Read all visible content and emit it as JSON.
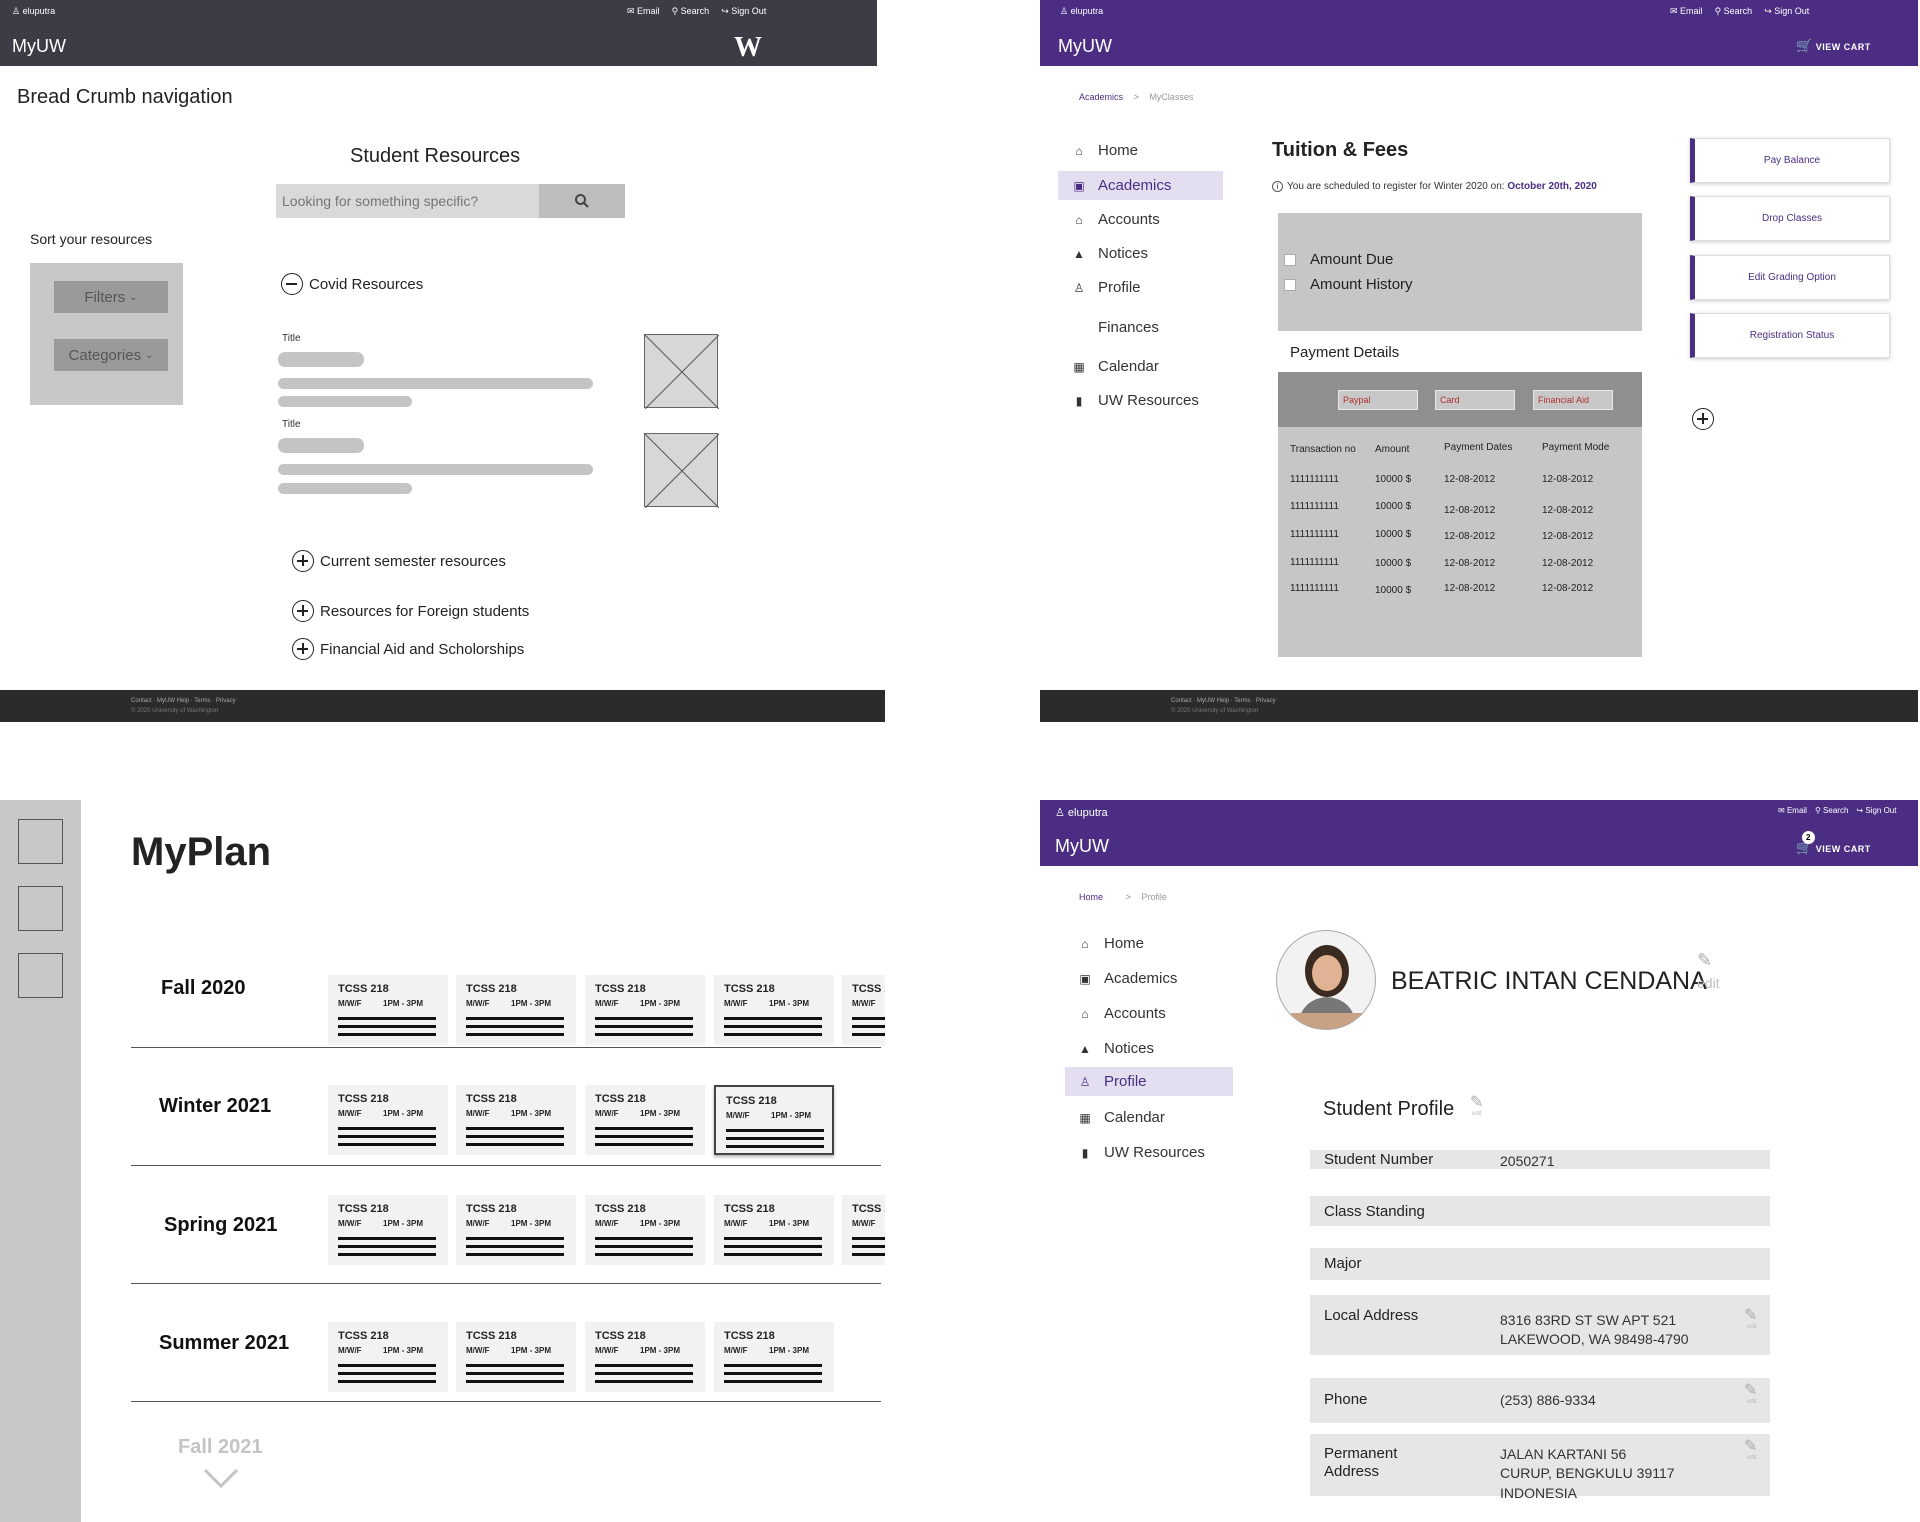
{
  "p1": {
    "user": "eluputra",
    "links": [
      "Email",
      "Search",
      "Sign Out"
    ],
    "brand": "MyUW",
    "logo": "W",
    "bc": "Bread Crumb navigation",
    "sr": "Student Resources",
    "placeholder": "Looking for something specific?",
    "sort": "Sort your resources",
    "filters": "Filters",
    "categories": "Categories",
    "covid": "Covid Resources",
    "title1": "Title",
    "title2": "Title",
    "current": "Current semester resources",
    "foreign": "Resources for Foreign students",
    "aid": "Financial Aid and Scholorships",
    "footer_links": "Contact · MyUW Help · Terms · Privacy",
    "copyright": "© 2020 University of Washington"
  },
  "p2": {
    "user": "eluputra",
    "links": [
      "Email",
      "Search",
      "Sign Out"
    ],
    "brand": "MyUW",
    "cart": "VIEW CART",
    "crumb1": "Academics",
    "crumb2": "MyClasses",
    "nav": [
      "Home",
      "Academics",
      "Accounts",
      "Notices",
      "Profile",
      "Finances",
      "Calendar",
      "UW Resources"
    ],
    "heading": "Tuition & Fees",
    "notice": "You are scheduled to register for Winter 2020 on:",
    "notice_date": "October 20th, 2020",
    "due": "Amount Due",
    "history": "Amount History",
    "payhdr": "Payment Details",
    "tabs": [
      "Paypal",
      "Card",
      "Financial Aid"
    ],
    "cols": [
      "Transaction no",
      "Amount",
      "Payment Dates",
      "Payment Mode"
    ],
    "rows": [
      [
        "1111111111",
        "10000 $",
        "12-08-2012",
        "12-08-2012"
      ],
      [
        "1111111111",
        "10000 $",
        "12-08-2012",
        "12-08-2012"
      ],
      [
        "1111111111",
        "10000 $",
        "12-08-2012",
        "12-08-2012"
      ],
      [
        "1111111111",
        "10000 $",
        "12-08-2012",
        "12-08-2012"
      ],
      [
        "1111111111",
        "10000 $",
        "12-08-2012",
        "12-08-2012"
      ]
    ],
    "actions": [
      "Pay Balance",
      "Drop Classes",
      "Edit Grading Option",
      "Registration Status"
    ],
    "footer_links": "Contact · MyUW Help · Terms · Privacy",
    "copyright": "© 2020 University of Washington"
  },
  "p3": {
    "title": "MyPlan",
    "terms": [
      "Fall 2020",
      "Winter 2021",
      "Spring 2021",
      "Summer 2021"
    ],
    "next": "Fall 2021",
    "course": "TCSS 218",
    "days": "M/W/F",
    "time": "1PM - 3PM"
  },
  "p4": {
    "user": "eluputra",
    "links": [
      "Email",
      "Search",
      "Sign Out"
    ],
    "brand": "MyUW",
    "cart": "VIEW CART",
    "cart_count": "2",
    "crumb1": "Home",
    "crumb2": "Profile",
    "nav": [
      "Home",
      "Academics",
      "Accounts",
      "Notices",
      "Profile",
      "Calendar",
      "UW Resources"
    ],
    "name": "BEATRIC INTAN CENDANA",
    "edit": "edit",
    "sp": "Student Profile",
    "fields": {
      "num_k": "Student Number",
      "num_v": "2050271",
      "cls_k": "Class Standing",
      "maj_k": "Major",
      "loc_k": "Local Address",
      "loc_v1": "8316 83RD ST SW APT 521",
      "loc_v2": "LAKEWOOD, WA 98498-4790",
      "ph_k": "Phone",
      "ph_v": "(253) 886-9334",
      "perm_k1": "Permanent",
      "perm_k2": "Address",
      "perm_v1": "JALAN KARTANI 56",
      "perm_v2": "CURUP, BENGKULU 39117",
      "perm_v3": "INDONESIA"
    }
  }
}
